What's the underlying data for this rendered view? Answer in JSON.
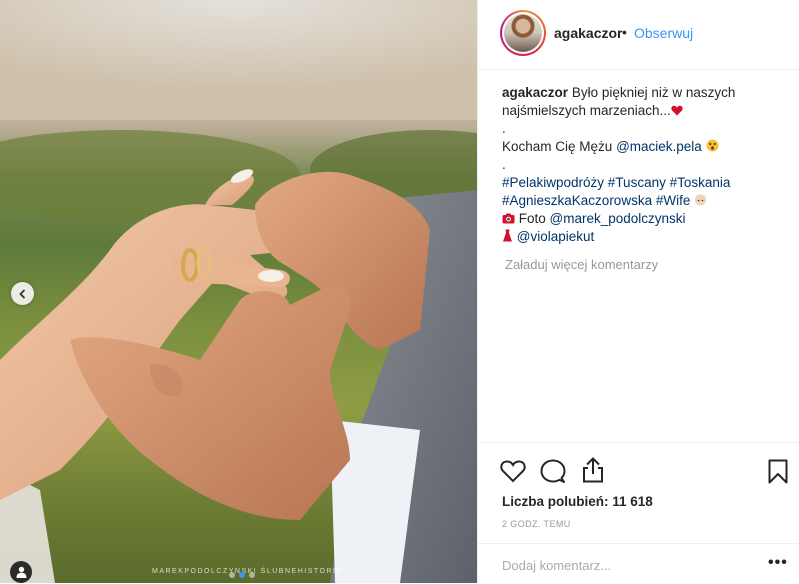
{
  "post": {
    "image_alt": "",
    "watermark": "MAREKPODOLCZYNSKI  ŚLUBNEHISTORIE",
    "carousel": {
      "count": 3,
      "active": 1
    }
  },
  "header": {
    "username": "agakaczor",
    "bullet": "•",
    "follow_label": "Obserwuj"
  },
  "caption": {
    "author": "agakaczor",
    "line1_text": "Było piękniej niż w naszych",
    "line2_text": "najśmielszych marzeniach...",
    "dot1": ".",
    "line3_text": "Kocham Cię Mężu",
    "mention1": "@maciek.pela",
    "dot2": ".",
    "hashtags_line1": "#Pelakiwpodróży #Tuscany #Toskania",
    "hashtags_line2": "#AgnieszkaKaczorowska #Wife",
    "photo_label": "Foto",
    "mention2": "@marek_podolczynski",
    "mention3": "@violapiekut"
  },
  "load_more": "Załaduj więcej komentarzy",
  "likes": "Liczba polubień: 11 618",
  "timestamp": "2 GODZ. TEMU",
  "comment": {
    "placeholder": "Dodaj komentarz..."
  },
  "more_label": "•••",
  "colors": {
    "link": "#003569",
    "follow": "#3897f0",
    "muted": "#999999"
  },
  "icons": [
    "heart-icon",
    "comment-icon",
    "share-icon",
    "bookmark-icon",
    "chevron-left-icon",
    "user-tag-icon",
    "red-heart-emoji",
    "camera-emoji",
    "dress-emoji"
  ]
}
